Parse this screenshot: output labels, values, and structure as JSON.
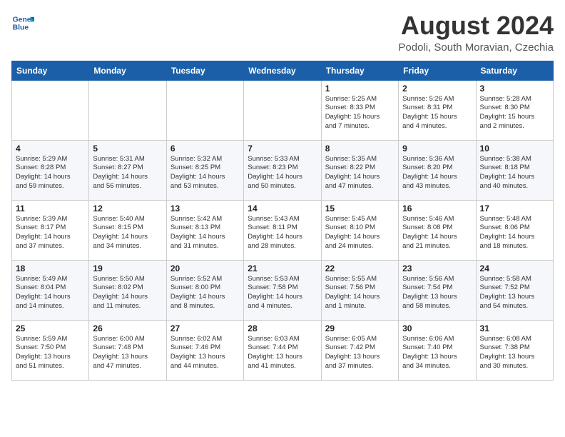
{
  "header": {
    "logo_line1": "General",
    "logo_line2": "Blue",
    "month_title": "August 2024",
    "subtitle": "Podoli, South Moravian, Czechia"
  },
  "days_of_week": [
    "Sunday",
    "Monday",
    "Tuesday",
    "Wednesday",
    "Thursday",
    "Friday",
    "Saturday"
  ],
  "weeks": [
    [
      {
        "day": "",
        "info": ""
      },
      {
        "day": "",
        "info": ""
      },
      {
        "day": "",
        "info": ""
      },
      {
        "day": "",
        "info": ""
      },
      {
        "day": "1",
        "info": "Sunrise: 5:25 AM\nSunset: 8:33 PM\nDaylight: 15 hours\nand 7 minutes."
      },
      {
        "day": "2",
        "info": "Sunrise: 5:26 AM\nSunset: 8:31 PM\nDaylight: 15 hours\nand 4 minutes."
      },
      {
        "day": "3",
        "info": "Sunrise: 5:28 AM\nSunset: 8:30 PM\nDaylight: 15 hours\nand 2 minutes."
      }
    ],
    [
      {
        "day": "4",
        "info": "Sunrise: 5:29 AM\nSunset: 8:28 PM\nDaylight: 14 hours\nand 59 minutes."
      },
      {
        "day": "5",
        "info": "Sunrise: 5:31 AM\nSunset: 8:27 PM\nDaylight: 14 hours\nand 56 minutes."
      },
      {
        "day": "6",
        "info": "Sunrise: 5:32 AM\nSunset: 8:25 PM\nDaylight: 14 hours\nand 53 minutes."
      },
      {
        "day": "7",
        "info": "Sunrise: 5:33 AM\nSunset: 8:23 PM\nDaylight: 14 hours\nand 50 minutes."
      },
      {
        "day": "8",
        "info": "Sunrise: 5:35 AM\nSunset: 8:22 PM\nDaylight: 14 hours\nand 47 minutes."
      },
      {
        "day": "9",
        "info": "Sunrise: 5:36 AM\nSunset: 8:20 PM\nDaylight: 14 hours\nand 43 minutes."
      },
      {
        "day": "10",
        "info": "Sunrise: 5:38 AM\nSunset: 8:18 PM\nDaylight: 14 hours\nand 40 minutes."
      }
    ],
    [
      {
        "day": "11",
        "info": "Sunrise: 5:39 AM\nSunset: 8:17 PM\nDaylight: 14 hours\nand 37 minutes."
      },
      {
        "day": "12",
        "info": "Sunrise: 5:40 AM\nSunset: 8:15 PM\nDaylight: 14 hours\nand 34 minutes."
      },
      {
        "day": "13",
        "info": "Sunrise: 5:42 AM\nSunset: 8:13 PM\nDaylight: 14 hours\nand 31 minutes."
      },
      {
        "day": "14",
        "info": "Sunrise: 5:43 AM\nSunset: 8:11 PM\nDaylight: 14 hours\nand 28 minutes."
      },
      {
        "day": "15",
        "info": "Sunrise: 5:45 AM\nSunset: 8:10 PM\nDaylight: 14 hours\nand 24 minutes."
      },
      {
        "day": "16",
        "info": "Sunrise: 5:46 AM\nSunset: 8:08 PM\nDaylight: 14 hours\nand 21 minutes."
      },
      {
        "day": "17",
        "info": "Sunrise: 5:48 AM\nSunset: 8:06 PM\nDaylight: 14 hours\nand 18 minutes."
      }
    ],
    [
      {
        "day": "18",
        "info": "Sunrise: 5:49 AM\nSunset: 8:04 PM\nDaylight: 14 hours\nand 14 minutes."
      },
      {
        "day": "19",
        "info": "Sunrise: 5:50 AM\nSunset: 8:02 PM\nDaylight: 14 hours\nand 11 minutes."
      },
      {
        "day": "20",
        "info": "Sunrise: 5:52 AM\nSunset: 8:00 PM\nDaylight: 14 hours\nand 8 minutes."
      },
      {
        "day": "21",
        "info": "Sunrise: 5:53 AM\nSunset: 7:58 PM\nDaylight: 14 hours\nand 4 minutes."
      },
      {
        "day": "22",
        "info": "Sunrise: 5:55 AM\nSunset: 7:56 PM\nDaylight: 14 hours\nand 1 minute."
      },
      {
        "day": "23",
        "info": "Sunrise: 5:56 AM\nSunset: 7:54 PM\nDaylight: 13 hours\nand 58 minutes."
      },
      {
        "day": "24",
        "info": "Sunrise: 5:58 AM\nSunset: 7:52 PM\nDaylight: 13 hours\nand 54 minutes."
      }
    ],
    [
      {
        "day": "25",
        "info": "Sunrise: 5:59 AM\nSunset: 7:50 PM\nDaylight: 13 hours\nand 51 minutes."
      },
      {
        "day": "26",
        "info": "Sunrise: 6:00 AM\nSunset: 7:48 PM\nDaylight: 13 hours\nand 47 minutes."
      },
      {
        "day": "27",
        "info": "Sunrise: 6:02 AM\nSunset: 7:46 PM\nDaylight: 13 hours\nand 44 minutes."
      },
      {
        "day": "28",
        "info": "Sunrise: 6:03 AM\nSunset: 7:44 PM\nDaylight: 13 hours\nand 41 minutes."
      },
      {
        "day": "29",
        "info": "Sunrise: 6:05 AM\nSunset: 7:42 PM\nDaylight: 13 hours\nand 37 minutes."
      },
      {
        "day": "30",
        "info": "Sunrise: 6:06 AM\nSunset: 7:40 PM\nDaylight: 13 hours\nand 34 minutes."
      },
      {
        "day": "31",
        "info": "Sunrise: 6:08 AM\nSunset: 7:38 PM\nDaylight: 13 hours\nand 30 minutes."
      }
    ]
  ]
}
